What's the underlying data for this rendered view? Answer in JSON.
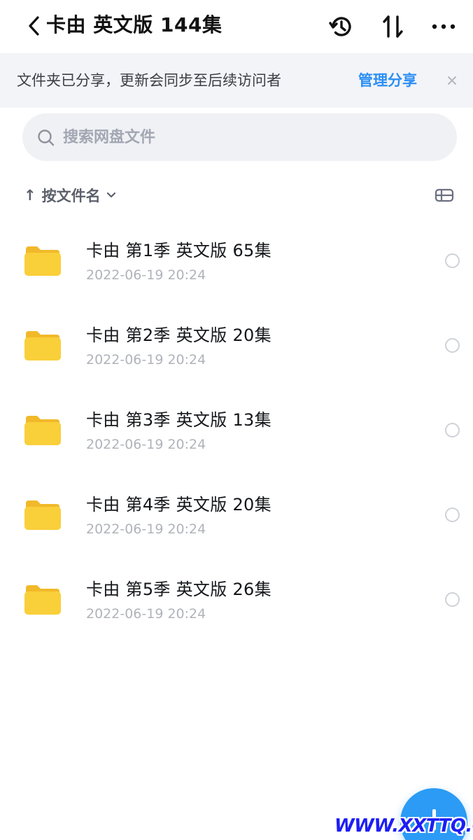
{
  "header": {
    "title": "卡由 英文版 144集",
    "back_icon": "chevron-left-icon",
    "history_icon": "history-icon",
    "sort_icon": "swap-vertical-icon",
    "more_icon": "more-horizontal-icon"
  },
  "banner": {
    "text": "文件夹已分享，更新会同步至后续访问者",
    "manage_label": "管理分享",
    "close_icon": "close-icon"
  },
  "search": {
    "placeholder": "搜索网盘文件",
    "value": ""
  },
  "sort": {
    "label": "按文件名",
    "arrow": "↑"
  },
  "files": [
    {
      "name": "卡由 第1季 英文版 65集",
      "date": "2022-06-19 20:24"
    },
    {
      "name": "卡由 第2季 英文版 20集",
      "date": "2022-06-19 20:24"
    },
    {
      "name": "卡由 第3季 英文版 13集",
      "date": "2022-06-19 20:24"
    },
    {
      "name": "卡由 第4季 英文版 20集",
      "date": "2022-06-19 20:24"
    },
    {
      "name": "卡由 第5季 英文版 26集",
      "date": "2022-06-19 20:24"
    }
  ],
  "watermark": "WWW.XXTTQ.COM",
  "colors": {
    "accent": "#2a8ef5",
    "fab": "#2b9bf5",
    "folder": "#f7c631",
    "banner_bg": "#f3f4f7",
    "search_bg": "#f0f1f5",
    "watermark": "#1d1ef5"
  }
}
